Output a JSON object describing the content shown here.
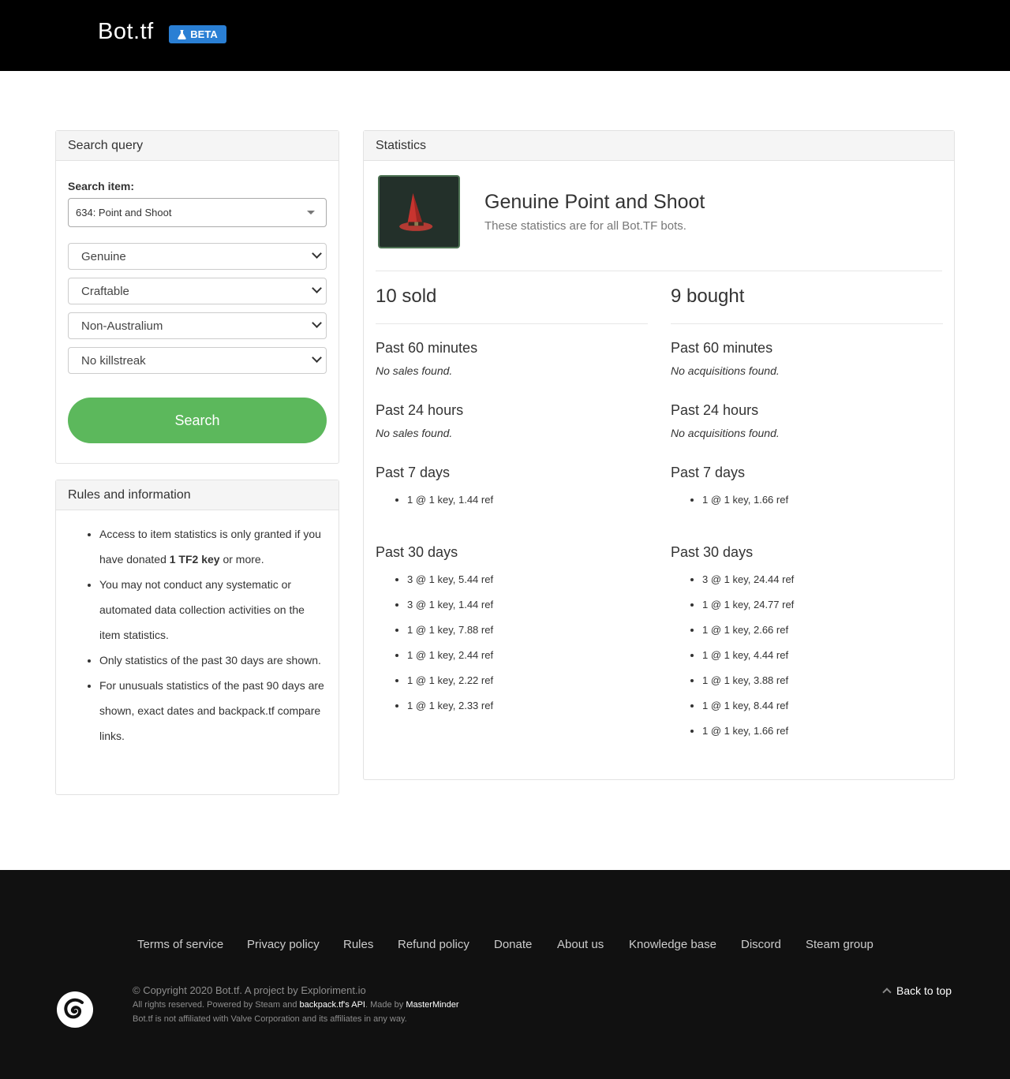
{
  "header": {
    "brand": "Bot.tf",
    "beta_label": "BETA"
  },
  "search_panel": {
    "title": "Search query",
    "item_label": "Search item:",
    "item_value": "634: Point and Shoot",
    "quality": "Genuine",
    "craftable": "Craftable",
    "australium": "Non-Australium",
    "killstreak": "No killstreak",
    "search_button": "Search"
  },
  "rules_panel": {
    "title": "Rules and information",
    "rule1_pre": "Access to item statistics is only granted if you have donated ",
    "rule1_bold": "1 TF2 key",
    "rule1_post": " or more.",
    "rule2": "You may not conduct any systematic or automated data collection activities on the item statistics.",
    "rule3": "Only statistics of the past 30 days are shown.",
    "rule4": "For unusuals statistics of the past 90 days are shown, exact dates and backpack.tf compare links."
  },
  "stats": {
    "title": "Statistics",
    "item_name": "Genuine Point and Shoot",
    "item_sub": "These statistics are for all Bot.TF bots.",
    "sold": {
      "title": "10 sold",
      "h60": "Past 60 minutes",
      "h60_note": "No sales found.",
      "h24": "Past 24 hours",
      "h24_note": "No sales found.",
      "d7": "Past 7 days",
      "d7_items": [
        "1 @ 1 key, 1.44 ref"
      ],
      "d30": "Past 30 days",
      "d30_items": [
        "3 @ 1 key, 5.44 ref",
        "3 @ 1 key, 1.44 ref",
        "1 @ 1 key, 7.88 ref",
        "1 @ 1 key, 2.44 ref",
        "1 @ 1 key, 2.22 ref",
        "1 @ 1 key, 2.33 ref"
      ]
    },
    "bought": {
      "title": "9 bought",
      "h60": "Past 60 minutes",
      "h60_note": "No acquisitions found.",
      "h24": "Past 24 hours",
      "h24_note": "No acquisitions found.",
      "d7": "Past 7 days",
      "d7_items": [
        "1 @ 1 key, 1.66 ref"
      ],
      "d30": "Past 30 days",
      "d30_items": [
        "3 @ 1 key, 24.44 ref",
        "1 @ 1 key, 24.77 ref",
        "1 @ 1 key, 2.66 ref",
        "1 @ 1 key, 4.44 ref",
        "1 @ 1 key, 3.88 ref",
        "1 @ 1 key, 8.44 ref",
        "1 @ 1 key, 1.66 ref"
      ]
    }
  },
  "footer": {
    "links": [
      "Terms of service",
      "Privacy policy",
      "Rules",
      "Refund policy",
      "Donate",
      "About us",
      "Knowledge base",
      "Discord",
      "Steam group"
    ],
    "copyright": "© Copyright 2020 Bot.tf. A project by Exploriment.io",
    "powered_pre": "All rights reserved. Powered by Steam and ",
    "powered_link": "backpack.tf's API",
    "powered_mid": ". Made by ",
    "powered_author": "MasterMinder",
    "disclaimer": "Bot.tf is not affiliated with Valve Corporation and its affiliates in any way.",
    "back_to_top": "Back to top"
  }
}
